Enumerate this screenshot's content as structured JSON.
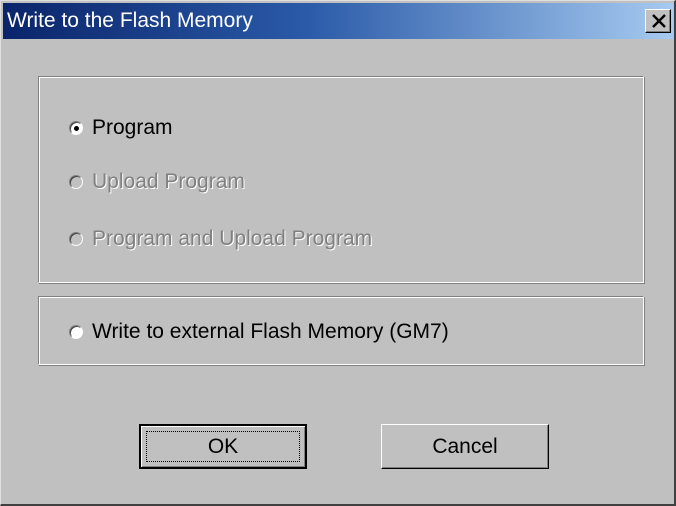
{
  "window": {
    "title": "Write to the Flash Memory",
    "close_icon": "close-x-icon"
  },
  "options": {
    "program": {
      "label": "Program",
      "selected": true,
      "enabled": true
    },
    "upload_program": {
      "label": "Upload Program",
      "selected": false,
      "enabled": false
    },
    "program_and_upload": {
      "label": "Program and Upload Program",
      "selected": false,
      "enabled": false
    },
    "external_flash": {
      "label": "Write to external Flash Memory (GM7)",
      "selected": false,
      "enabled": true
    }
  },
  "buttons": {
    "ok_label": "OK",
    "cancel_label": "Cancel"
  },
  "colors": {
    "titlebar_start": "#0a246a",
    "titlebar_end": "#a6caf0",
    "dialog_face": "#c0c0c0",
    "disabled_text": "#808080"
  }
}
